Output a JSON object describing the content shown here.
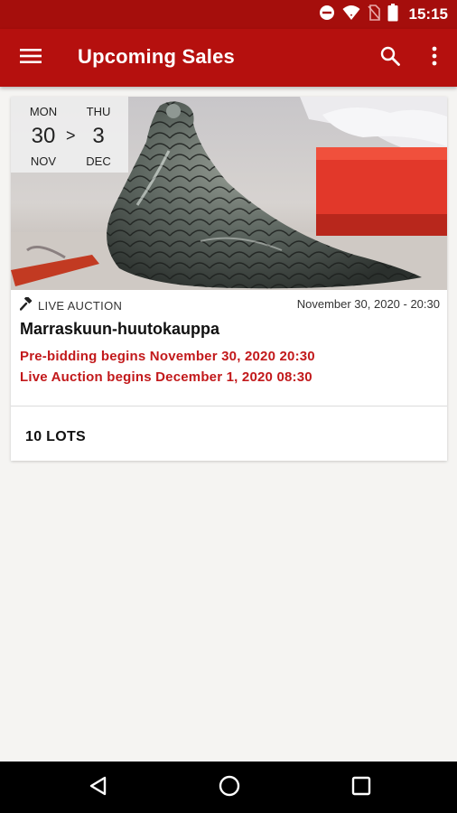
{
  "status_bar": {
    "time": "15:15",
    "icons": [
      "do-not-disturb-icon",
      "wifi-icon",
      "no-sim-icon",
      "battery-icon"
    ]
  },
  "app_bar": {
    "title": "Upcoming Sales",
    "icons": [
      "menu-icon",
      "search-icon",
      "more-vert-icon"
    ]
  },
  "sale": {
    "date_range": {
      "start_dow": "MON",
      "start_day": "30",
      "start_month": "NOV",
      "separator": ">",
      "end_dow": "THU",
      "end_day": "3",
      "end_month": "DEC"
    },
    "auction_type": "LIVE AUCTION",
    "auction_type_icon": "gavel-icon",
    "datetime": "November 30, 2020 - 20:30",
    "title": "Marraskuun-huutokauppa",
    "prebidding": "Pre-bidding begins November 30, 2020  20:30",
    "live_begins": "Live Auction begins December 1, 2020  08:30",
    "lots_label": "10 LOTS"
  },
  "nav_bar": {
    "icons": [
      "back-icon",
      "home-icon",
      "recents-icon"
    ]
  },
  "colors": {
    "status_bar": "#a50e0c",
    "app_bar": "#b5100e",
    "accent_text": "#c2191b",
    "background": "#f5f4f2"
  }
}
